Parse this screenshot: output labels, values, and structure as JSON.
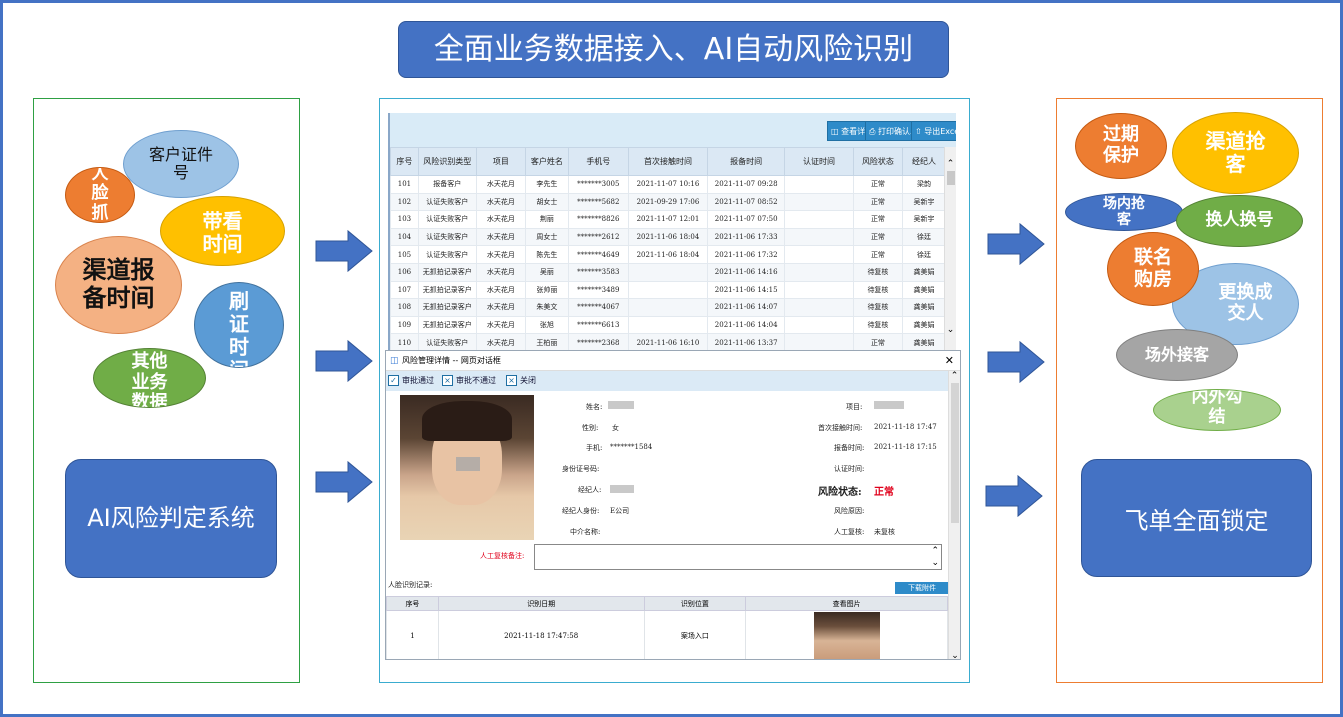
{
  "title": "全面业务数据接入、AI自动风险识别",
  "left_panel": {
    "bubbles": {
      "face_capture": "人脸抓拍",
      "customer_id": "客户证件号",
      "showing_time": "带看时间",
      "channel_report": "渠道报备时间",
      "id_swipe": "刷证时间",
      "other_data": "其他业务数据"
    },
    "system_label": "AI风险判定系统"
  },
  "right_panel": {
    "bubbles": {
      "expired": "过期保护",
      "channel_grab": "渠道抢客",
      "onsite_grab": "场内抢客",
      "swap_number": "换人换号",
      "joint_purchase": "联名购房",
      "change_buyer": "更换成交人",
      "offsite_grab": "场外接客",
      "collusion": "内外勾结"
    },
    "lock_label": "飞单全面锁定"
  },
  "toolbar": {
    "view_details": "查看详情",
    "print_confirm": "打印确认单",
    "export_excel": "导出Excel"
  },
  "table": {
    "headers": [
      "序号",
      "风险识别类型",
      "项目",
      "客户姓名",
      "手机号",
      "首次接触时间",
      "报备时间",
      "认证时间",
      "风险状态",
      "经纪人"
    ],
    "rows": [
      [
        "101",
        "报备客户",
        "水天花月",
        "李先生",
        "*******3005",
        "2021-11-07 10:16",
        "2021-11-07 09:28",
        "",
        "正常",
        "梁韵"
      ],
      [
        "102",
        "认证失败客户",
        "水天花月",
        "胡女士",
        "*******5682",
        "2021-09-29 17:06",
        "2021-11-07 08:52",
        "",
        "正常",
        "吴新宇"
      ],
      [
        "103",
        "认证失败客户",
        "水天花月",
        "荆丽",
        "*******8826",
        "2021-11-07 12:01",
        "2021-11-07 07:50",
        "",
        "正常",
        "吴新宇"
      ],
      [
        "104",
        "认证失败客户",
        "水天花月",
        "周女士",
        "*******2612",
        "2021-11-06 18:04",
        "2021-11-06 17:33",
        "",
        "正常",
        "徐廷"
      ],
      [
        "105",
        "认证失败客户",
        "水天花月",
        "陈先生",
        "*******4649",
        "2021-11-06 18:04",
        "2021-11-06 17:32",
        "",
        "正常",
        "徐廷"
      ],
      [
        "106",
        "无抓拍记录客户",
        "水天花月",
        "吴丽",
        "*******3583",
        "",
        "2021-11-06 14:16",
        "",
        "待复核",
        "龚美娟"
      ],
      [
        "107",
        "无抓拍记录客户",
        "水天花月",
        "张帅丽",
        "*******3489",
        "",
        "2021-11-06 14:15",
        "",
        "待复核",
        "龚美娟"
      ],
      [
        "108",
        "无抓拍记录客户",
        "水天花月",
        "朱美文",
        "*******4067",
        "",
        "2021-11-06 14:07",
        "",
        "待复核",
        "龚美娟"
      ],
      [
        "109",
        "无抓拍记录客户",
        "水天花月",
        "张旭",
        "*******6613",
        "",
        "2021-11-06 14:04",
        "",
        "待复核",
        "龚美娟"
      ],
      [
        "110",
        "认证失败客户",
        "水天花月",
        "王柏丽",
        "*******2368",
        "2021-11-06 16:10",
        "2021-11-06 13:37",
        "",
        "正常",
        "龚美娟"
      ]
    ]
  },
  "dialog": {
    "title": "风险管理详情 -- 网页对话框",
    "approve": "审批通过",
    "reject": "审批不通过",
    "close": "关闭",
    "fields": {
      "name_label": "姓名:",
      "gender_label": "性别:",
      "gender_value": "女",
      "phone_label": "手机:",
      "phone_value": "*******1584",
      "id_label": "身份证号码:",
      "agent_label": "经纪人:",
      "agent_identity_label": "经纪人身份:",
      "agent_identity_value": "E公司",
      "intermediary_label": "中介名称:",
      "project_label": "项目:",
      "first_contact_label": "首次接触时间:",
      "first_contact_value": "2021-11-18 17:47",
      "report_time_label": "报备时间:",
      "report_time_value": "2021-11-18 17:15",
      "auth_time_label": "认证时间:",
      "risk_status_label": "风险状态:",
      "risk_status_value": "正常",
      "risk_reason_label": "风险原因:",
      "manual_review_label": "人工复核:",
      "manual_review_value": "未复核",
      "review_note_label": "人工复核备注:"
    },
    "record_title": "人脸识别记录:",
    "download": "下载附件",
    "record_headers": [
      "序号",
      "识别日期",
      "识别位置",
      "查看图片"
    ],
    "record_row": [
      "1",
      "2021-11-18 17:47:58",
      "案场入口"
    ]
  },
  "colors": {
    "accent_blue": "#4472c4",
    "orange": "#ed7d31",
    "gold": "#ffc000",
    "salmon": "#f4b183",
    "light_blue": "#9dc3e6",
    "green": "#70ad47",
    "gray": "#a5a5a5",
    "risk_red": "#e0001b"
  }
}
